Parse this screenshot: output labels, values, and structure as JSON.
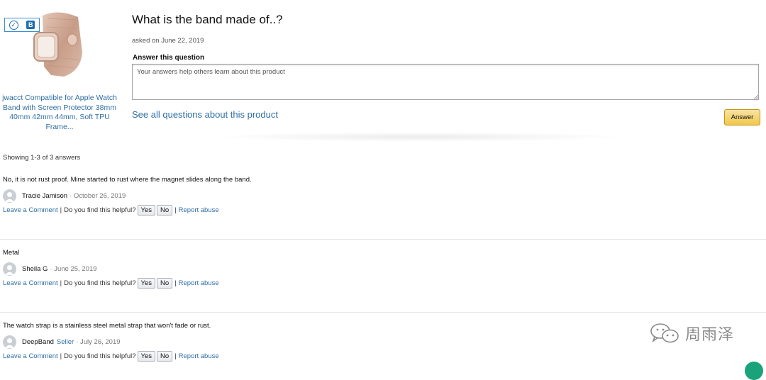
{
  "product": {
    "title": "jwacct Compatible for Apple Watch Band with Screen Protector 38mm 40mm 42mm 44mm, Soft TPU Frame...",
    "badge_letter": "B"
  },
  "question": {
    "title": "What is the band made of..?",
    "asked": "asked on June 22, 2019",
    "answer_label": "Answer this question",
    "placeholder": "Your answers help others learn about this product",
    "see_all": "See all questions about this product",
    "answer_button": "Answer"
  },
  "showing": "Showing 1-3 of 3 answers",
  "answers": [
    {
      "text": "No, it is not rust proof. Mine started to rust where the magnet slides along the band.",
      "author": "Tracie Jamison",
      "date": "· October 26, 2019"
    },
    {
      "text": "Metal",
      "author": "Sheila G",
      "date": "· June 25, 2019"
    },
    {
      "text": "The watch strap is a stainless steel metal strap that won't fade or rust.",
      "author": "DeepBand",
      "seller": "Seller",
      "date": "· July 26, 2019"
    }
  ],
  "actions": {
    "comment": "Leave a Comment",
    "helpful": "Do you find this helpful?",
    "yes": "Yes",
    "no": "No",
    "report": "Report abuse",
    "divider": "|"
  },
  "watermark": "周雨泽",
  "colors": {
    "link": "#2f6ea5",
    "answer_button": "#f1c74a",
    "band": "#d7b3a0"
  }
}
